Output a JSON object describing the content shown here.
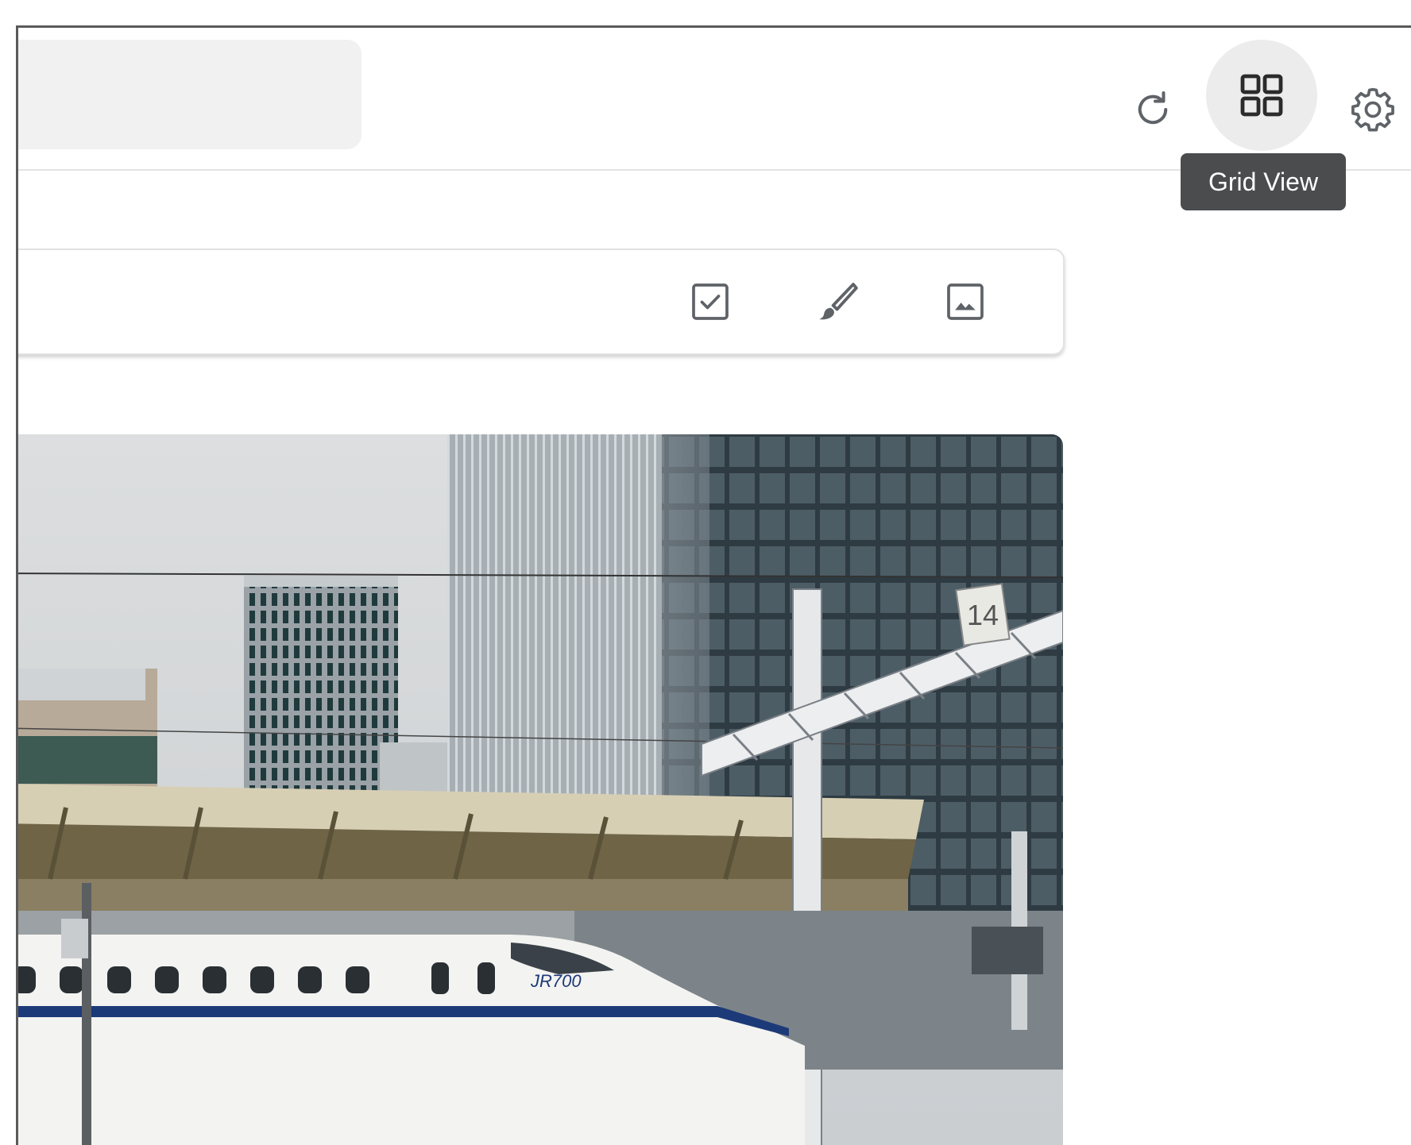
{
  "toolbar": {
    "search_placeholder": "",
    "refresh_icon": "refresh-icon",
    "grid_icon": "grid-view-icon",
    "settings_icon": "gear-icon",
    "tooltip": "Grid View"
  },
  "note_bar": {
    "checkbox_icon": "checkbox-icon",
    "brush_icon": "brush-icon",
    "image_icon": "image-icon"
  },
  "photo": {
    "platform_number": "14",
    "train_label": "JR700"
  }
}
